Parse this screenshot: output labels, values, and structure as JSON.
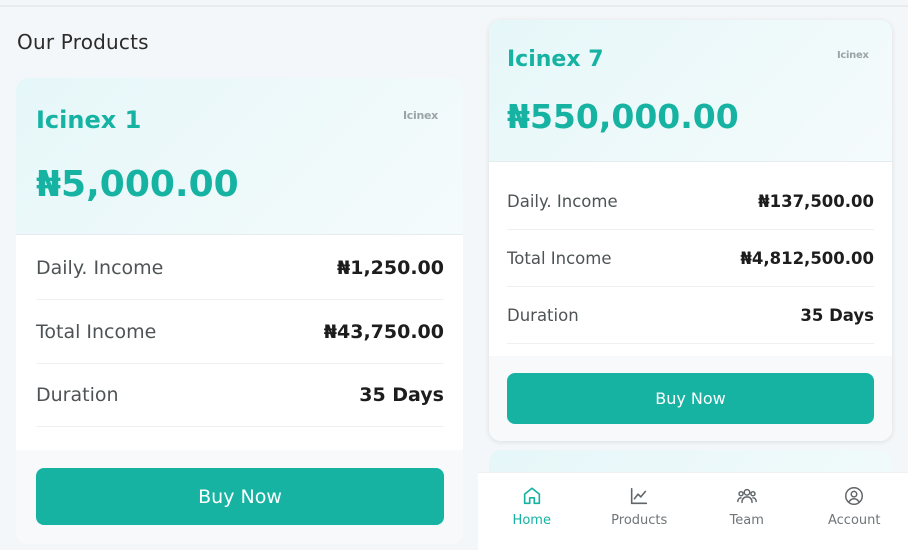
{
  "colors": {
    "accent": "#16b3a3",
    "page_bg": "#f4f7f9"
  },
  "left": {
    "heading": "Our Products",
    "card": {
      "name": "Icinex 1",
      "logo": "Icinex",
      "price": "₦5,000.00",
      "rows": [
        {
          "label": "Daily. Income",
          "value": "₦1,250.00"
        },
        {
          "label": "Total Income",
          "value": "₦43,750.00"
        },
        {
          "label": "Duration",
          "value": "35 Days"
        }
      ],
      "button": "Buy Now"
    }
  },
  "right": {
    "card": {
      "name": "Icinex 7",
      "logo": "Icinex",
      "price": "₦550,000.00",
      "rows": [
        {
          "label": "Daily. Income",
          "value": "₦137,500.00"
        },
        {
          "label": "Total Income",
          "value": "₦4,812,500.00"
        },
        {
          "label": "Duration",
          "value": "35 Days"
        }
      ],
      "button": "Buy Now"
    },
    "nav": [
      {
        "label": "Home",
        "icon": "home-icon",
        "active": true
      },
      {
        "label": "Products",
        "icon": "chart-icon",
        "active": false
      },
      {
        "label": "Team",
        "icon": "team-icon",
        "active": false
      },
      {
        "label": "Account",
        "icon": "account-icon",
        "active": false
      }
    ]
  }
}
